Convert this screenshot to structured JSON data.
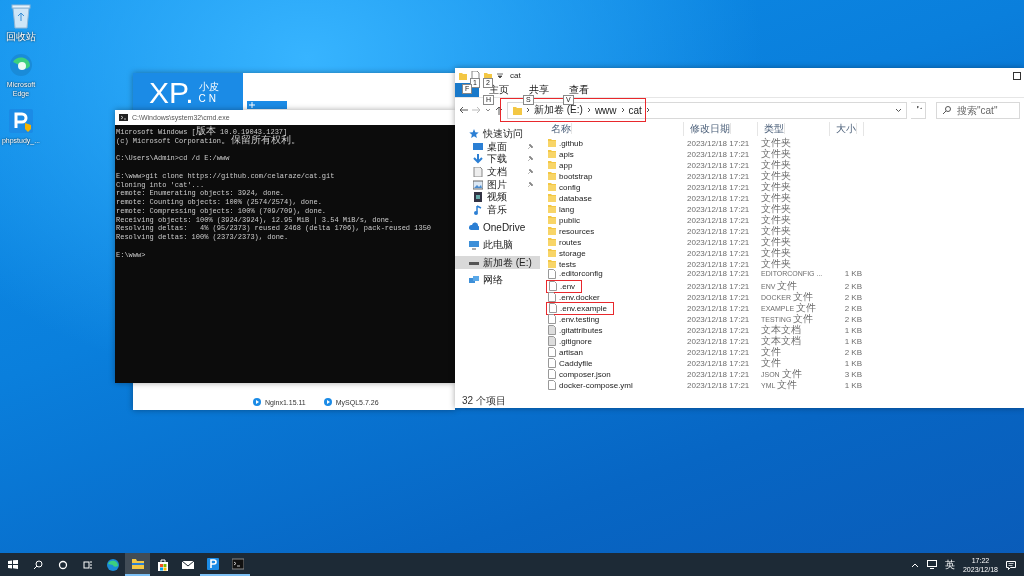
{
  "desktop_icons": [
    {
      "kind": "recycle-bin",
      "label": "回收站"
    },
    {
      "kind": "edge",
      "label": "Microsoft Edge"
    },
    {
      "kind": "phpstudy",
      "label": "phpstudy_..."
    }
  ],
  "phpstudy_window": {
    "brand": {
      "logo": "XP.",
      "name": "小皮",
      "suffix": "CN"
    },
    "services": [
      {
        "label": "Nginx1.15.11"
      },
      {
        "label": "MySQL5.7.26"
      }
    ]
  },
  "cmd_window": {
    "title": "C:\\Windows\\system32\\cmd.exe",
    "blocks": [
      [
        "Microsoft Windows [版本 10.0.19043.1237]",
        "(c) Microsoft Corporation。保留所有权利。"
      ],
      [
        "C:\\Users\\Admin>cd /d E:/www"
      ],
      [
        "E:\\www>git clone https://github.com/celaraze/cat.git",
        "Cloning into 'cat'...",
        "remote: Enumerating objects: 3924, done.",
        "remote: Counting objects: 100% (2574/2574), done.",
        "remote: Compressing objects: 100% (709/709), done.",
        "Receiving objects: 100% (3924/3924), 12.95 MiB | 3.54 MiB/s, done.",
        "Resolving deltas:   4% (95/2373) reused 2468 (delta 1706), pack-reused 1350",
        "Resolving deltas: 100% (2373/2373), done."
      ],
      [
        "E:\\www>"
      ]
    ]
  },
  "explorer": {
    "title": "cat",
    "quick_toolbar": [
      {
        "kind": "properties",
        "keytip": "1"
      },
      {
        "kind": "new-folder",
        "keytip": "2"
      }
    ],
    "tabs": [
      {
        "kind": "file",
        "keytip": "F",
        "selected": false
      },
      {
        "kind": "tab",
        "label": "主页",
        "keytip": "H",
        "selected": false
      },
      {
        "kind": "tab",
        "label": "共享",
        "keytip": "S",
        "selected": false
      },
      {
        "kind": "tab",
        "label": "查看",
        "keytip": "V",
        "selected": false
      }
    ],
    "address": {
      "highlighted": true,
      "crumbs": [
        "新加卷 (E:)",
        "www",
        "cat"
      ]
    },
    "search": {
      "placeholder": "搜索\"cat\""
    },
    "columns": [
      "名称",
      "修改日期",
      "类型",
      "大小"
    ],
    "sidebar": [
      {
        "label": "快速访问",
        "kind": "star",
        "selected": false,
        "children": [
          {
            "label": "桌面",
            "kind": "desktop",
            "pinned": true,
            "selected": false
          },
          {
            "label": "下载",
            "kind": "download",
            "pinned": true,
            "selected": false
          },
          {
            "label": "文档",
            "kind": "document",
            "pinned": true,
            "selected": false
          },
          {
            "label": "图片",
            "kind": "pictures",
            "pinned": true,
            "selected": false
          },
          {
            "label": "视频",
            "kind": "video",
            "pinned": false,
            "selected": false
          },
          {
            "label": "音乐",
            "kind": "music",
            "pinned": false,
            "selected": false
          }
        ]
      },
      {
        "label": "OneDrive",
        "kind": "cloud",
        "selected": false
      },
      {
        "label": "此电脑",
        "kind": "computer",
        "selected": false
      },
      {
        "label": "新加卷 (E:)",
        "kind": "drive",
        "selected": true
      },
      {
        "label": "网络",
        "kind": "network",
        "selected": false
      }
    ],
    "files": [
      {
        "name": ".github",
        "date": "2023/12/18 17:21",
        "type": "文件夹",
        "kind": "folder",
        "highlighted": false
      },
      {
        "name": "apis",
        "date": "2023/12/18 17:21",
        "type": "文件夹",
        "kind": "folder",
        "highlighted": false
      },
      {
        "name": "app",
        "date": "2023/12/18 17:21",
        "type": "文件夹",
        "kind": "folder",
        "highlighted": false
      },
      {
        "name": "bootstrap",
        "date": "2023/12/18 17:21",
        "type": "文件夹",
        "kind": "folder",
        "highlighted": false
      },
      {
        "name": "config",
        "date": "2023/12/18 17:21",
        "type": "文件夹",
        "kind": "folder",
        "highlighted": false
      },
      {
        "name": "database",
        "date": "2023/12/18 17:21",
        "type": "文件夹",
        "kind": "folder",
        "highlighted": false
      },
      {
        "name": "lang",
        "date": "2023/12/18 17:21",
        "type": "文件夹",
        "kind": "folder",
        "highlighted": false
      },
      {
        "name": "public",
        "date": "2023/12/18 17:21",
        "type": "文件夹",
        "kind": "folder",
        "highlighted": false
      },
      {
        "name": "resources",
        "date": "2023/12/18 17:21",
        "type": "文件夹",
        "kind": "folder",
        "highlighted": false
      },
      {
        "name": "routes",
        "date": "2023/12/18 17:21",
        "type": "文件夹",
        "kind": "folder",
        "highlighted": false
      },
      {
        "name": "storage",
        "date": "2023/12/18 17:21",
        "type": "文件夹",
        "kind": "folder",
        "highlighted": false
      },
      {
        "name": "tests",
        "date": "2023/12/18 17:21",
        "type": "文件夹",
        "kind": "folder",
        "highlighted": false
      },
      {
        "name": ".editorconfig",
        "date": "2023/12/18 17:21",
        "type": "EDITORCONFIG ...",
        "size": "1 KB",
        "kind": "file",
        "highlighted": false
      },
      {
        "name": ".env",
        "date": "2023/12/18 17:21",
        "type": "ENV 文件",
        "size": "2 KB",
        "kind": "file",
        "highlighted": true
      },
      {
        "name": ".env.docker",
        "date": "2023/12/18 17:21",
        "type": "DOCKER 文件",
        "size": "2 KB",
        "kind": "file",
        "highlighted": false
      },
      {
        "name": ".env.example",
        "date": "2023/12/18 17:21",
        "type": "EXAMPLE 文件",
        "size": "2 KB",
        "kind": "file",
        "highlighted": true
      },
      {
        "name": ".env.testing",
        "date": "2023/12/18 17:21",
        "type": "TESTING 文件",
        "size": "2 KB",
        "kind": "file",
        "highlighted": false
      },
      {
        "name": ".gitattributes",
        "date": "2023/12/18 17:21",
        "type": "文本文档",
        "size": "1 KB",
        "kind": "text",
        "highlighted": false
      },
      {
        "name": ".gitignore",
        "date": "2023/12/18 17:21",
        "type": "文本文档",
        "size": "1 KB",
        "kind": "text",
        "highlighted": false
      },
      {
        "name": "artisan",
        "date": "2023/12/18 17:21",
        "type": "文件",
        "size": "2 KB",
        "kind": "file",
        "highlighted": false
      },
      {
        "name": "Caddyfile",
        "date": "2023/12/18 17:21",
        "type": "文件",
        "size": "1 KB",
        "kind": "file",
        "highlighted": false
      },
      {
        "name": "composer.json",
        "date": "2023/12/18 17:21",
        "type": "JSON 文件",
        "size": "3 KB",
        "kind": "file",
        "highlighted": false
      },
      {
        "name": "docker-compose.yml",
        "date": "2023/12/18 17:21",
        "type": "YML 文件",
        "size": "1 KB",
        "kind": "file",
        "highlighted": false
      }
    ],
    "status": "32 个项目"
  },
  "taskbar": {
    "apps": [
      {
        "kind": "edge",
        "open": false,
        "selected": false
      },
      {
        "kind": "explorer",
        "open": true,
        "selected": true
      },
      {
        "kind": "store",
        "open": false,
        "selected": false
      },
      {
        "kind": "mail",
        "open": false,
        "selected": false
      },
      {
        "kind": "phpstudy",
        "open": true,
        "selected": false
      },
      {
        "kind": "cmd",
        "open": true,
        "selected": false
      }
    ],
    "input_method": "英",
    "time": "17:22",
    "date": "2023/12/18"
  }
}
